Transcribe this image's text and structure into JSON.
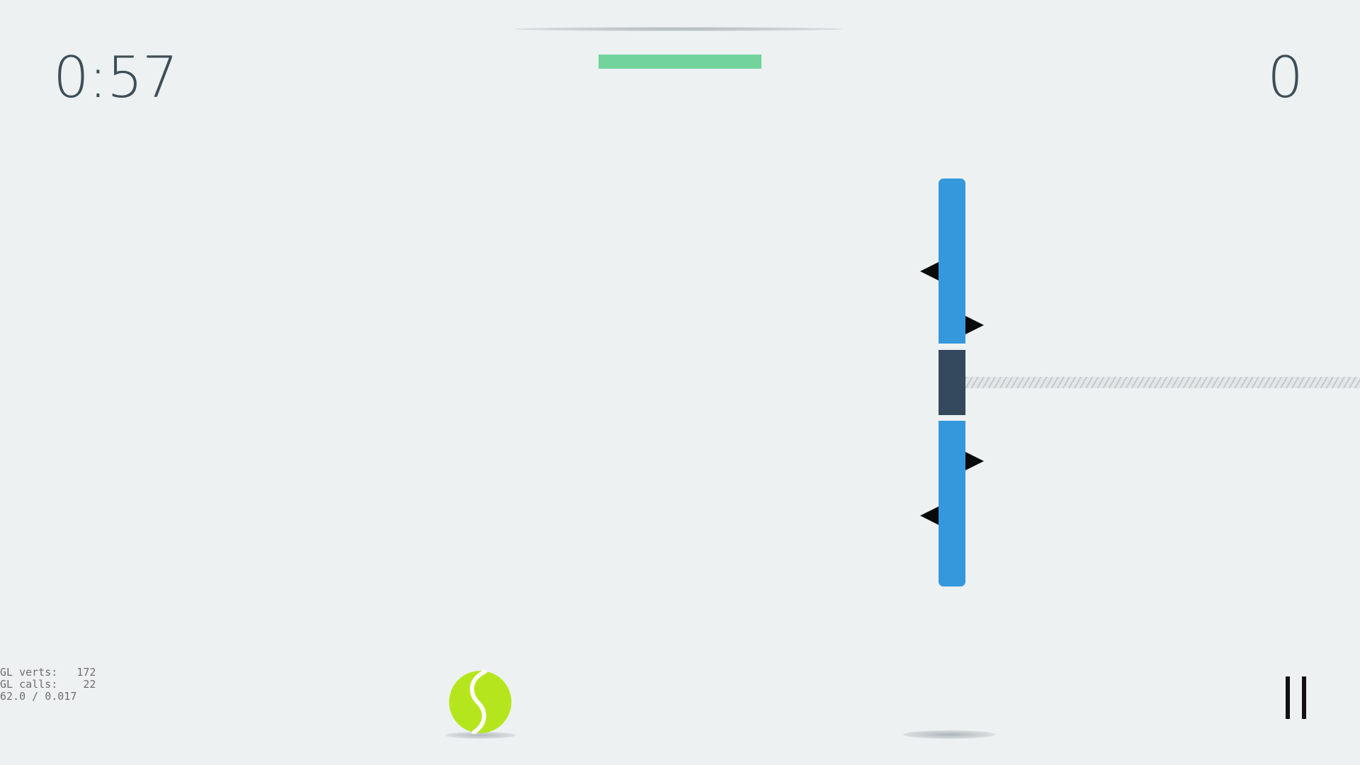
{
  "hud": {
    "timer": "0:57",
    "score": "0",
    "progress": 1.0
  },
  "debug": {
    "line1": "GL verts:   172",
    "line2": "GL calls:    22",
    "line3": "62.0 / 0.017"
  },
  "icons": {
    "ball": "tennis-ball-icon",
    "pause": "pause-icon"
  },
  "colors": {
    "background": "#edf1f2",
    "pole": "#3598dc",
    "pole_gap": "#34495e",
    "progress": "#73d39c",
    "ball": "#b5e61d",
    "text": "#3d4e57"
  }
}
